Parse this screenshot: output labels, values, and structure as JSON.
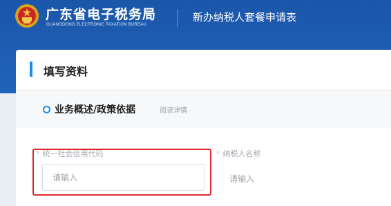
{
  "header": {
    "brand_title": "广东省电子税务局",
    "brand_subtitle": "GUANGDONG ELECTRONIC TAXATION BUREAU",
    "page_title": "新办纳税人套餐申请表",
    "background_color": "#1e5db2",
    "logo_icon": "national-emblem-icon"
  },
  "section": {
    "title": "填写资料",
    "accent_color": "#1c8ce8"
  },
  "subsection": {
    "title": "业务概述/政策依据",
    "read_more": "阅读详情"
  },
  "form": {
    "fields": [
      {
        "required_mark": "*",
        "label": "统一社会信用代码",
        "placeholder": "请输入",
        "value": "",
        "highlighted": true
      },
      {
        "required_mark": "*",
        "label": "纳税人名称",
        "placeholder": "请输入",
        "value": ""
      }
    ],
    "highlight_color": "#e2252b"
  }
}
